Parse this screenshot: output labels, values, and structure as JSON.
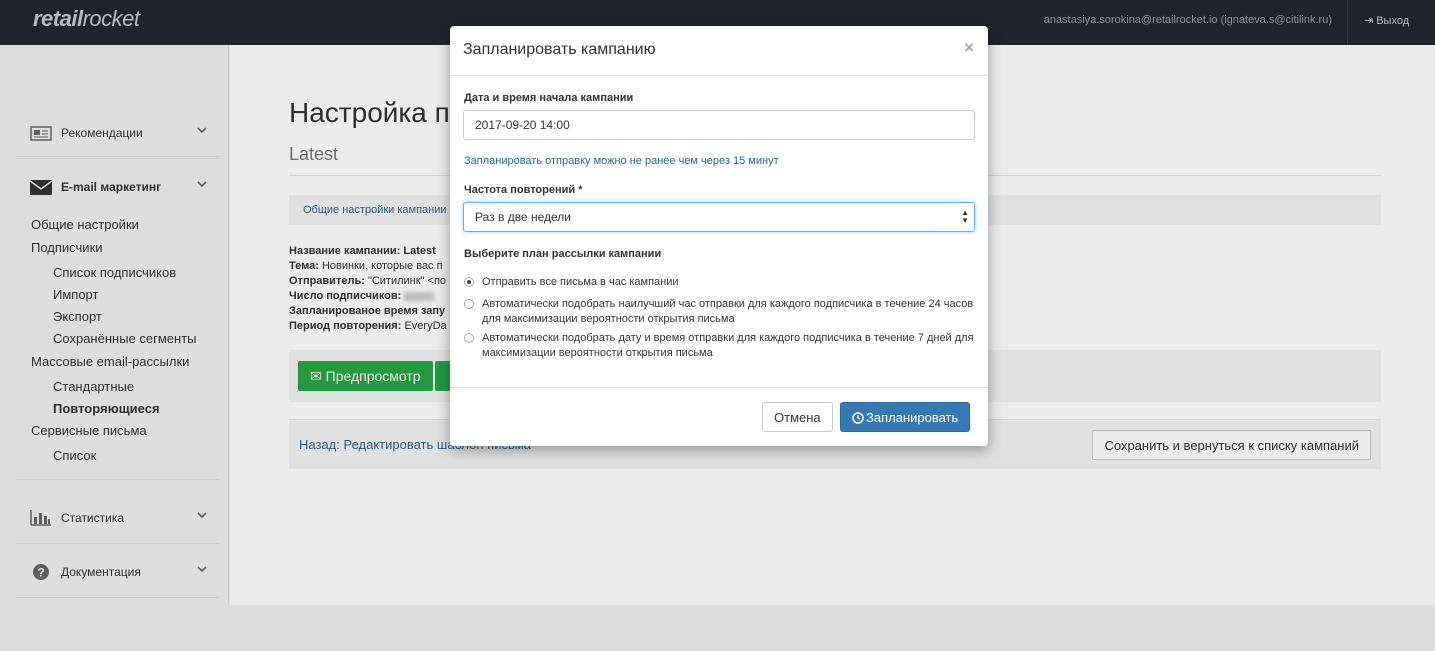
{
  "header": {
    "logo_bold": "retail",
    "logo_light": "rocket",
    "user_email": "anastasiya.sorokina@retailrocket.io (ignateva.s@citilink.ru)",
    "logout_label": "Выход"
  },
  "sidebar": {
    "recommendations": "Рекомендации",
    "email_marketing": "E-mail маркетинг",
    "links": {
      "general_settings": "Общие настройки",
      "subscribers": "Подписчики",
      "subscribers_list": "Список подписчиков",
      "import": "Импорт",
      "export": "Экспорт",
      "saved_segments": "Сохранённые сегменты",
      "mass_mailings": "Массовые email-рассылки",
      "standard": "Стандартные",
      "recurring": "Повторяющиеся",
      "service_letters": "Сервисные письма",
      "list": "Список"
    },
    "statistics": "Статистика",
    "documentation": "Документация"
  },
  "main": {
    "title": "Настройка п",
    "subtitle": "Latest",
    "tab_link": "Общие настройки кампании",
    "info": {
      "name_label": "Название кампании:",
      "name_value": "Latest",
      "subject_label": "Тема:",
      "subject_value": "Новинки, которые вас п",
      "sender_label": "Отправитель:",
      "sender_value": "\"Ситилинк\" <по",
      "subscribers_label": "Число подписчиков:",
      "scheduled_label": "Запланированое время запу",
      "period_label": "Период повторения:",
      "period_value": "EveryDa"
    },
    "preview_button": "Предпросмотр",
    "back_link": "Назад: Редактировать шаблон письма",
    "save_button": "Сохранить и вернуться к списку кампаний"
  },
  "modal": {
    "title": "Запланировать кампанию",
    "close": "×",
    "date_label": "Дата и время начала кампании",
    "date_value": "2017-09-20 14:00",
    "hint": "Запланировать отправку можно не ранее чем через 15 минут",
    "frequency_label": "Частота повторений *",
    "frequency_value": "Раз в две недели",
    "plan_label": "Выберите план рассылки кампании",
    "options": [
      {
        "label": "Отправить все письма в час кампании",
        "checked": true
      },
      {
        "label": "Автоматически подобрать наилучший час отправки для каждого подписчика в течение 24 часов для максимизации вероятности открытия письма",
        "checked": false
      },
      {
        "label": "Автоматически подобрать дату и время отправки для каждого подписчика в течение 7 дней для максимизации вероятности открытия письма",
        "checked": false
      }
    ],
    "cancel_button": "Отмена",
    "schedule_button": "Запланировать"
  }
}
